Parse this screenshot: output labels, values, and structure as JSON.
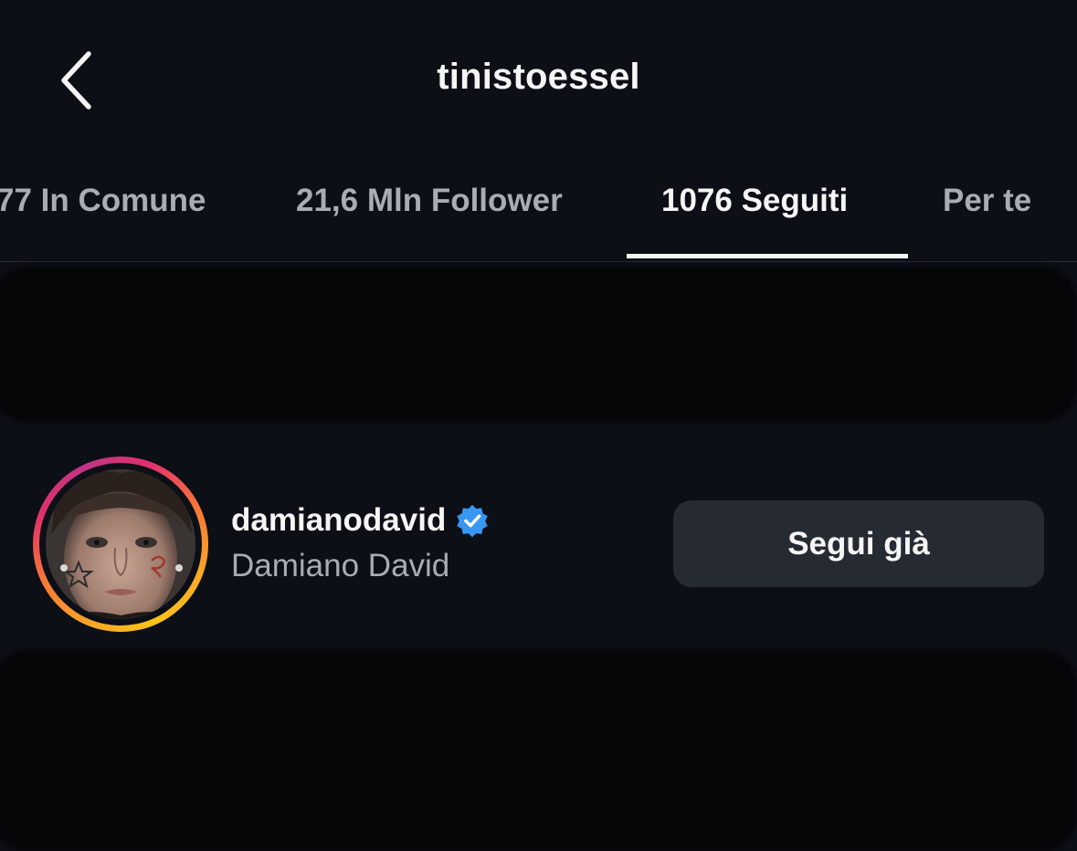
{
  "header": {
    "title": "tinistoessel",
    "back_icon": "chevron-left-icon"
  },
  "tabs": [
    {
      "label": "77 In Comune",
      "active": false
    },
    {
      "label": "21,6 Mln Follower",
      "active": false
    },
    {
      "label": "1076 Seguiti",
      "active": true
    },
    {
      "label": "Per te",
      "active": false
    }
  ],
  "list": {
    "items": [
      {
        "username": "damianodavid",
        "full_name": "Damiano David",
        "verified": true,
        "verified_icon": "verified-badge-icon",
        "button_label": "Segui già"
      }
    ]
  },
  "colors": {
    "background": "#0c0f16",
    "text_primary": "#f5f5f5",
    "text_secondary": "#a8acb3",
    "button_bg": "#262a33",
    "verified_blue": "#3897f0"
  }
}
